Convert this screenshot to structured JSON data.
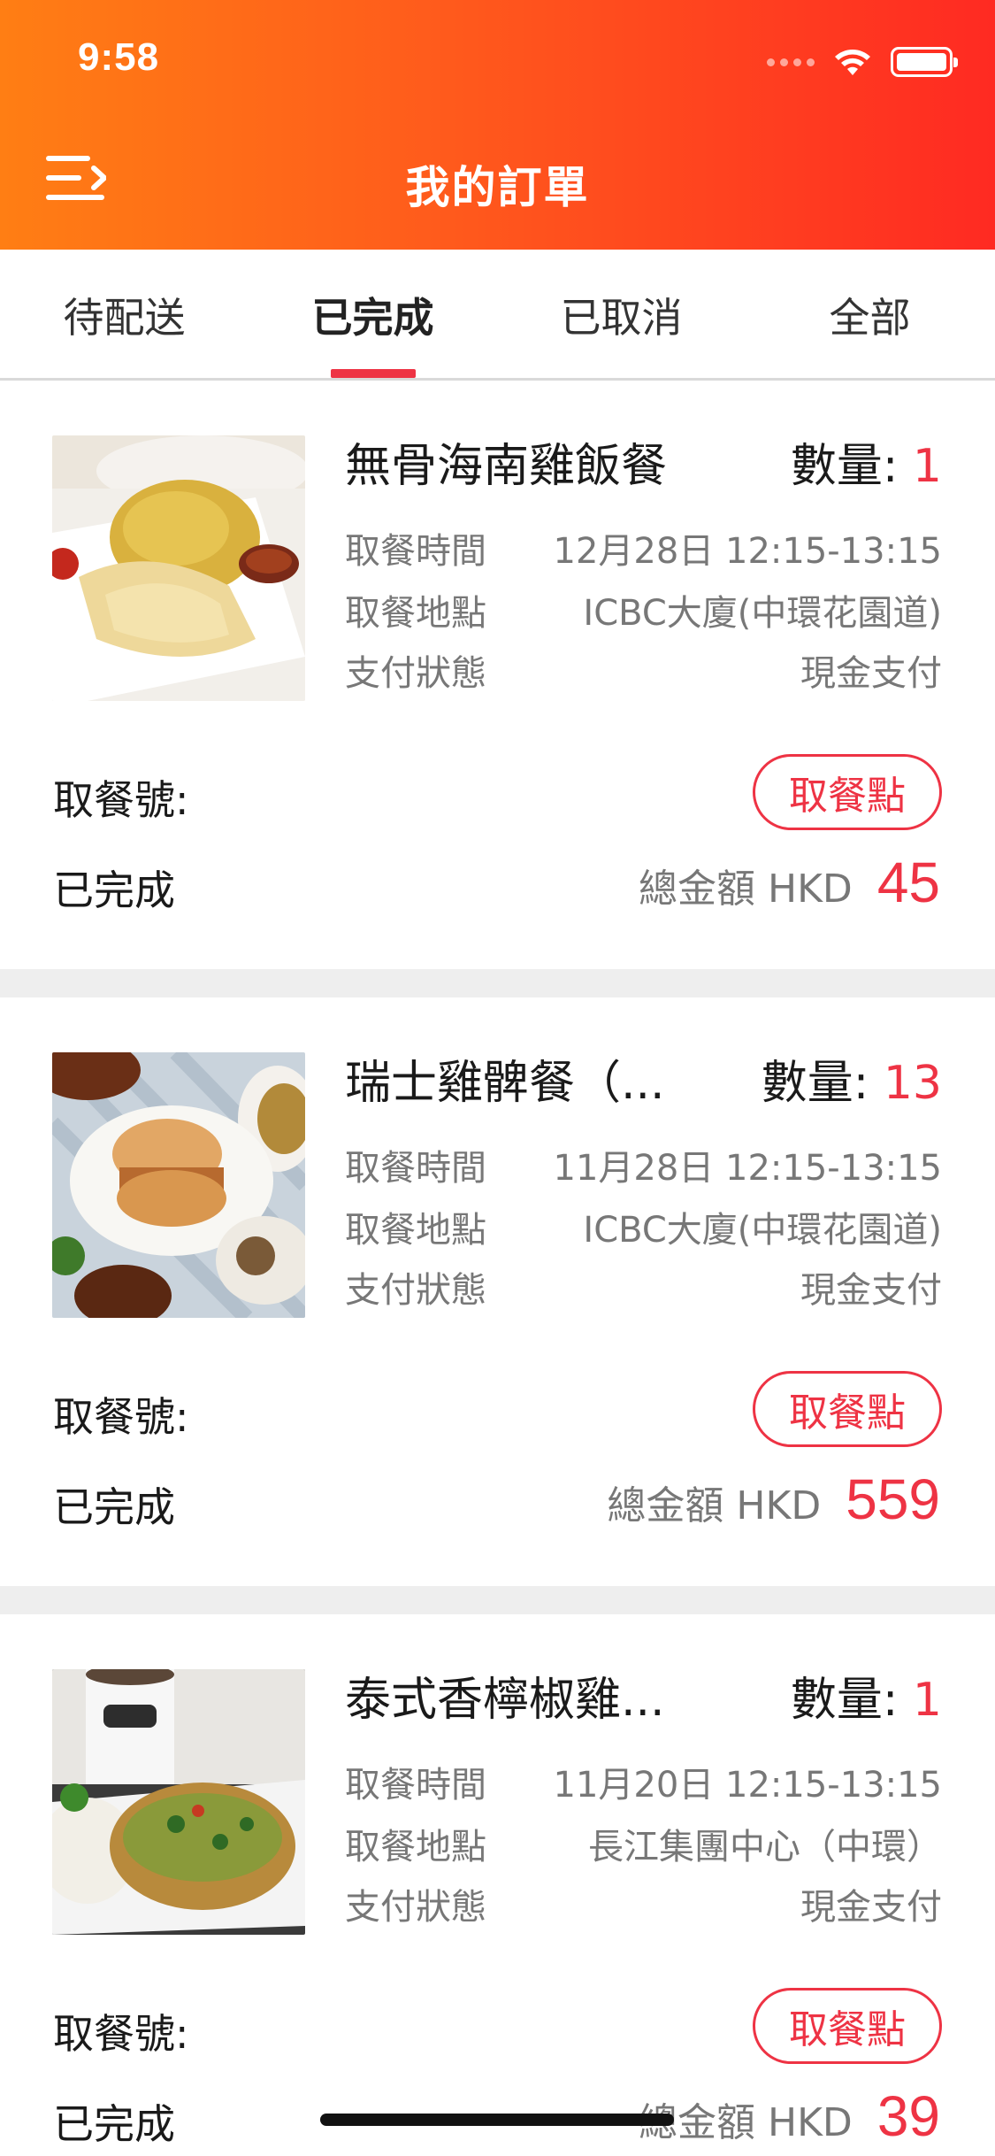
{
  "status_bar": {
    "time": "9:58"
  },
  "header": {
    "title": "我的訂單",
    "menu_icon": "menu-icon"
  },
  "tabs": [
    {
      "label": "待配送",
      "active": false
    },
    {
      "label": "已完成",
      "active": true
    },
    {
      "label": "已取消",
      "active": false
    },
    {
      "label": "全部",
      "active": false
    }
  ],
  "colors": {
    "accent": "#ee3344",
    "header_start": "#ff7e14",
    "header_end": "#ff2a22"
  },
  "orders": [
    {
      "name": "無骨海南雞飯餐",
      "qty_label": "數量:",
      "qty": "1",
      "time_label": "取餐時間",
      "time": "12月28日 12:15-13:15",
      "location_label": "取餐地點",
      "location": "ICBC大廈(中環花園道)",
      "payment_label": "支付狀態",
      "payment": "現金支付",
      "pickup_no_label": "取餐號:",
      "pickup_button": "取餐點",
      "status": "已完成",
      "total_label": "總金額 HKD",
      "total": "45"
    },
    {
      "name": "瑞士雞髀餐（...",
      "qty_label": "數量:",
      "qty": "13",
      "time_label": "取餐時間",
      "time": "11月28日 12:15-13:15",
      "location_label": "取餐地點",
      "location": "ICBC大廈(中環花園道)",
      "payment_label": "支付狀態",
      "payment": "現金支付",
      "pickup_no_label": "取餐號:",
      "pickup_button": "取餐點",
      "status": "已完成",
      "total_label": "總金額 HKD",
      "total": "559"
    },
    {
      "name": "泰式香檸椒雞...",
      "qty_label": "數量:",
      "qty": "1",
      "time_label": "取餐時間",
      "time": "11月20日 12:15-13:15",
      "location_label": "取餐地點",
      "location": "長江集團中心（中環）",
      "payment_label": "支付狀態",
      "payment": "現金支付",
      "pickup_no_label": "取餐號:",
      "pickup_button": "取餐點",
      "status": "已完成",
      "total_label": "總金額 HKD",
      "total": "39"
    }
  ]
}
